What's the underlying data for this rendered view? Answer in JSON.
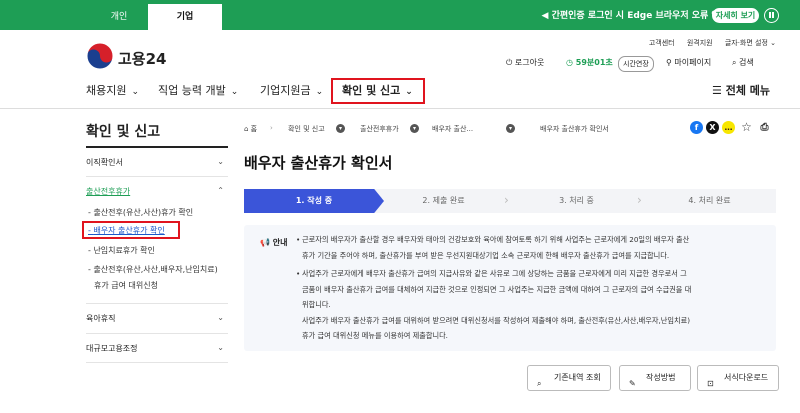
{
  "topbar": {
    "tabs": [
      "개인",
      "기업"
    ],
    "notice": "간편인증 로그인 시 Edge 브라우저 오류 안내",
    "detail_button": "자세히 보기",
    "brand_color": "#1e9e55"
  },
  "header": {
    "logo_text": "고용24",
    "util_links": [
      "고객센터",
      "원격지원",
      "글자·화면 설정 ⌄"
    ],
    "logout": "로그아웃",
    "timer": "59분01초",
    "extend": "시간연장",
    "mypage": "마이페이지",
    "search": "검색"
  },
  "nav": {
    "items": [
      "채용지원",
      "직업 능력 개발",
      "기업지원금",
      "확인 및 신고"
    ],
    "all_menu": "전체 메뉴"
  },
  "sidebar": {
    "title": "확인 및 신고",
    "items": [
      "이직확인서",
      "출산전후휴가",
      "육아휴직",
      "대규모고용조정"
    ],
    "sub_items": [
      "출산전후(유산,사산)휴가 확인",
      "배우자 출산휴가 확인",
      "난임치료휴가 확인",
      "출산전후(유산,사산,배우자,난임치료)",
      "휴가 급여 대위신청"
    ]
  },
  "breadcrumb": [
    "홈",
    "확인 및 신고",
    "출산전후휴가",
    "배우자 출산...",
    "배우자 출산휴가 확인서"
  ],
  "page_title": "배우자 출산휴가 확인서",
  "steps": [
    "1. 작성 중",
    "2. 제출 완료",
    "3. 처리 중",
    "4. 처리 완료"
  ],
  "notice_box": {
    "label": "안내",
    "p1": [
      "근로자의 배우자가 출산할 경우 배우자와 태아의 건강보호와 육아에 참여토록 하기 위해 사업주는 근로자에게 20일의 배우자 출산",
      "휴가 기간을 주어야 하며, 출산휴가를 부여 받은 우선지원대상기업 소속 근로자에 한해 배우자 출산휴가 급여를 지급합니다."
    ],
    "p2": [
      "사업주가 근로자에게 배우자 출산휴가 급여의 지급사유와 같은 사유로 그에 상당하는 금품을 근로자에게 미리 지급한 경우로서 그",
      "금품이 배우자 출산휴가 급여를 대체하여 지급한 것으로 인정되면 그 사업주는 지급한 금액에 대하여 그 근로자의 급여 수급권을 대",
      "위합니다.",
      "사업주가 배우자 출산휴가 급여를 대위하여 받으려면 대위신청서를 작성하여 제출해야 하며, 출산전후(유산,사산,배우자,난임치료)",
      "휴가 급여 대위신청 메뉴를 이용하여 제출합니다."
    ]
  },
  "buttons": [
    "기존내역 조회",
    "작성방법",
    "서식다운로드"
  ],
  "highlight_color": "#e0141e",
  "step_active_color": "#3b55d9"
}
